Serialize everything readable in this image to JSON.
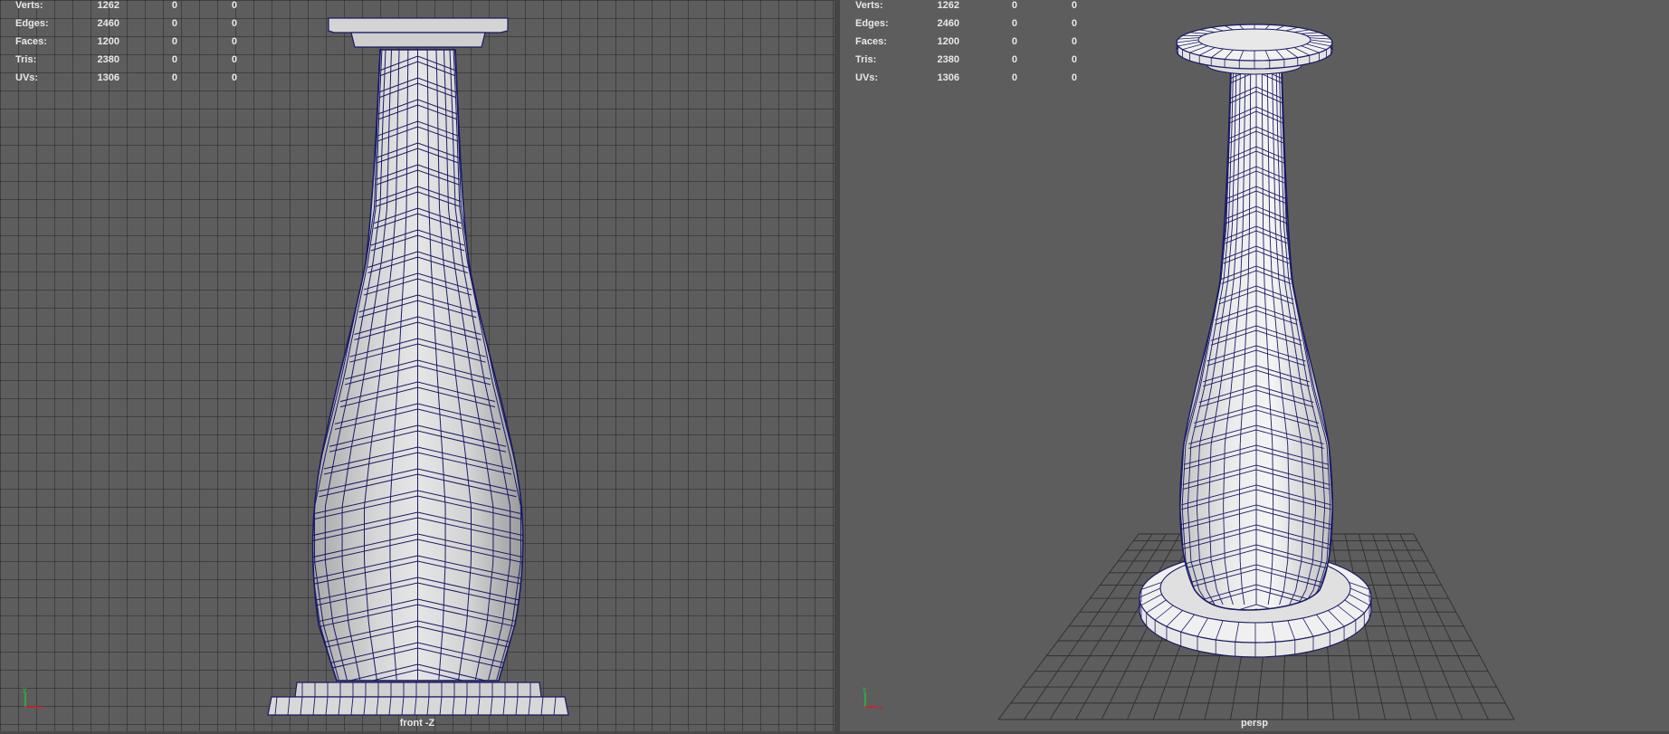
{
  "stats_rows": [
    {
      "label": "Verts:",
      "values": [
        "1262",
        "0",
        "0"
      ]
    },
    {
      "label": "Edges:",
      "values": [
        "2460",
        "0",
        "0"
      ]
    },
    {
      "label": "Faces:",
      "values": [
        "1200",
        "0",
        "0"
      ]
    },
    {
      "label": "Tris:",
      "values": [
        "2380",
        "0",
        "0"
      ]
    },
    {
      "label": "UVs:",
      "values": [
        "1306",
        "0",
        "0"
      ]
    }
  ],
  "viewports": {
    "front": {
      "camera_label": "front -Z"
    },
    "persp": {
      "camera_label": "persp"
    }
  },
  "gizmo": {
    "y": "y",
    "x": "x"
  },
  "colors": {
    "background": "#5d5d5d",
    "wireframe": "#1a1a66",
    "shade": "#d8d8d8",
    "axis_x": "#d22020",
    "axis_y": "#20c040"
  }
}
